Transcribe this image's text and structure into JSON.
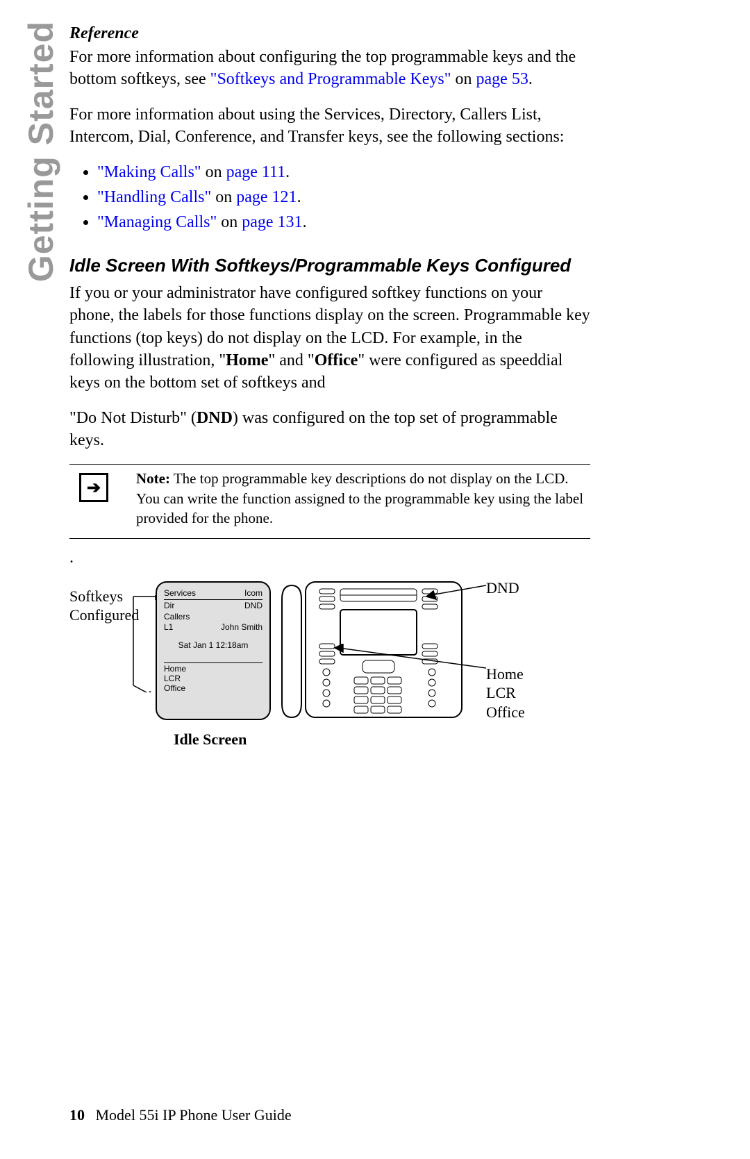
{
  "side_tab": "Getting Started",
  "reference": {
    "heading": "Reference",
    "para1_a": "For more information about configuring the top programmable keys and the bottom softkeys, see ",
    "link1": "\"Softkeys and Programmable Keys\"",
    "link1_join": " on ",
    "link1_page": "page 53",
    "para1_end": ".",
    "para2": "For more information about using the Services, Directory, Callers List, Intercom, Dial, Conference, and Transfer keys, see the following sections:",
    "bullets": [
      {
        "title": "\"Making Calls\"",
        "join": " on ",
        "page": "page 111",
        "end": "."
      },
      {
        "title": "\"Handling Calls\"",
        "join": " on ",
        "page": "page 121",
        "end": "."
      },
      {
        "title": "\"Managing Calls\"",
        "join": " on ",
        "page": "page 131",
        "end": "."
      }
    ]
  },
  "section2_heading": "Idle Screen With Softkeys/Programmable Keys Configured",
  "section2_p1_a": "If you or your administrator have configured softkey functions on your phone, the labels for those functions display on the screen. Programmable key functions (top keys) do not display on the LCD. For example, in the following illustration, \"",
  "section2_p1_home": "Home",
  "section2_p1_b": "\" and \"",
  "section2_p1_office": "Office",
  "section2_p1_c": "\" were configured as speeddial keys on the bottom set of softkeys and",
  "section2_p2_a": "\"Do Not Disturb\" (",
  "section2_p2_dnd": "DND",
  "section2_p2_b": ") was configured on the top set of programmable keys.",
  "note": {
    "lead": "Note:",
    "body": " The top programmable key descriptions do not display on the LCD. You can write the function assigned to the programmable key using the label provided for the phone."
  },
  "figure": {
    "left_label": "Softkeys\nConfigured",
    "right_top": "DND",
    "right_bottom": "Home\nLCR\nOffice",
    "caption": "Idle Screen",
    "lcd": {
      "r1l": "Services",
      "r1r": "Icom",
      "r2l": "Dir",
      "r2r": "DND",
      "r3l": "Callers",
      "r4l": "L1",
      "r4r": "John Smith",
      "date": "Sat  Jan 1  12:18am",
      "b1": "Home",
      "b2": "LCR",
      "b3": "Office"
    }
  },
  "footer": {
    "page": "10",
    "title": "Model 55i IP Phone User Guide"
  }
}
